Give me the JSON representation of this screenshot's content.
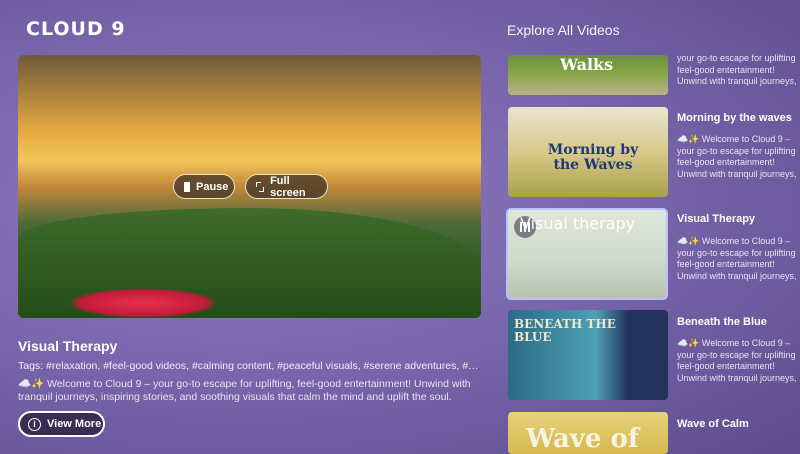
{
  "app": {
    "logo": "CLOUD 9"
  },
  "player": {
    "pause_label": "Pause",
    "fullscreen_label": "Full screen",
    "title": "Visual Therapy",
    "tags": "Tags: #relaxation, #feel-good videos, #calming content, #peaceful visuals, #serene adventures, #upli...",
    "description": "☁️✨ Welcome to Cloud 9 – your go-to escape for uplifting, feel-good entertainment! Unwind with tranquil journeys, inspiring stories, and soothing visuals that calm the mind and uplift the soul.",
    "view_more_label": "View More"
  },
  "sidebar": {
    "heading": "Explore All Videos",
    "items": [
      {
        "title": "",
        "thumb_word": "Walks",
        "desc": "your go-to escape for uplifting feel-good entertainment! Unwind with tranquil journeys,"
      },
      {
        "title": "Morning by the waves",
        "thumb_word": "Morning by the Waves",
        "desc": "☁️✨ Welcome to Cloud 9 – your go-to escape for uplifting feel-good entertainment! Unwind with tranquil journeys,"
      },
      {
        "title": "Visual Therapy",
        "thumb_word": "Visual therapy",
        "desc": "☁️✨ Welcome to Cloud 9 – your go-to escape for uplifting feel-good entertainment! Unwind with tranquil journeys,"
      },
      {
        "title": "Beneath the Blue",
        "thumb_word": "BENEATH THE BLUE",
        "desc": "☁️✨ Welcome to Cloud 9 – your go-to escape for uplifting feel-good entertainment! Unwind with tranquil journeys,"
      },
      {
        "title": "Wave of Calm",
        "thumb_word": "Wave of",
        "desc": ""
      }
    ]
  }
}
